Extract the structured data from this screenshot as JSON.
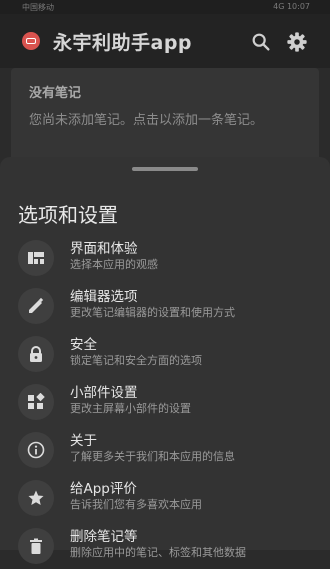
{
  "status_bar": {
    "left": "中国移动",
    "right": "4G 10:07"
  },
  "app_bar": {
    "title": "永宇利助手app"
  },
  "note_card": {
    "heading": "没有笔记",
    "body": "您尚未添加笔记。点击以添加一条笔记。"
  },
  "sheet": {
    "title": "选项和设置",
    "options": [
      {
        "label": "界面和体验",
        "desc": "选择本应用的观感",
        "icon": "layout-icon"
      },
      {
        "label": "编辑器选项",
        "desc": "更改笔记编辑器的设置和使用方式",
        "icon": "pencil-icon"
      },
      {
        "label": "安全",
        "desc": "锁定笔记和安全方面的选项",
        "icon": "lock-icon"
      },
      {
        "label": "小部件设置",
        "desc": "更改主屏幕小部件的设置",
        "icon": "widgets-icon"
      },
      {
        "label": "关于",
        "desc": "了解更多关于我们和本应用的信息",
        "icon": "info-icon"
      },
      {
        "label": "给App评价",
        "desc": "告诉我们您有多喜欢本应用",
        "icon": "star-icon"
      },
      {
        "label": "删除笔记等",
        "desc": "删除应用中的笔记、标签和其他数据",
        "icon": "trash-icon"
      }
    ]
  }
}
